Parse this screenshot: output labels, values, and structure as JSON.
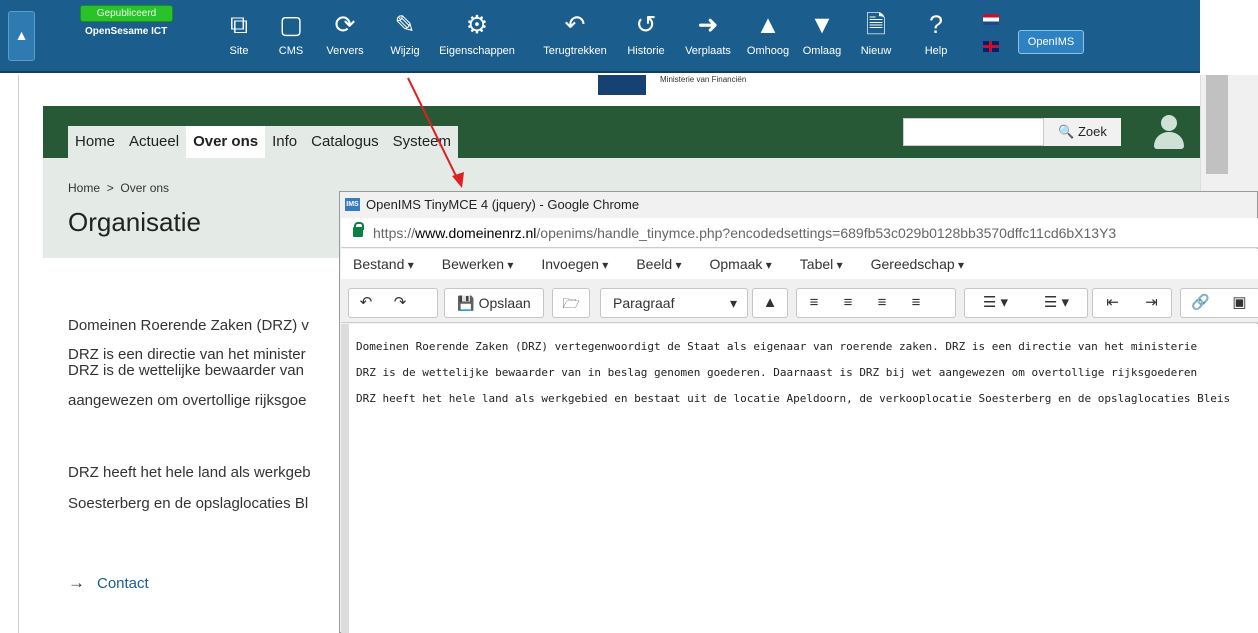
{
  "topbar": {
    "status_badge": "Gepubliceerd",
    "site_name": "OpenSesame ICT",
    "tools": [
      {
        "label": "Site",
        "icon": "expand-icon"
      },
      {
        "label": "CMS",
        "icon": "window-icon"
      },
      {
        "label": "Ververs",
        "icon": "refresh-icon"
      },
      {
        "label": "Wijzig",
        "icon": "edit-icon"
      },
      {
        "label": "Eigenschappen",
        "icon": "gear-icon"
      },
      {
        "label": "Terugtrekken",
        "icon": "undo-icon"
      },
      {
        "label": "Historie",
        "icon": "history-icon"
      },
      {
        "label": "Verplaats",
        "icon": "move-icon"
      },
      {
        "label": "Omhoog",
        "icon": "arrow-up-icon"
      },
      {
        "label": "Omlaag",
        "icon": "arrow-down-icon"
      },
      {
        "label": "Nieuw",
        "icon": "new-page-icon"
      },
      {
        "label": "Help",
        "icon": "help-icon"
      }
    ],
    "openims_button": "OpenIMS",
    "colors": {
      "bar": "#1b5e8e",
      "badge": "#29c229"
    }
  },
  "site": {
    "ministry_text": "Ministerie van Financiën",
    "nav": [
      "Home",
      "Actueel",
      "Over ons",
      "Info",
      "Catalogus",
      "Systeem"
    ],
    "nav_active": "Over ons",
    "search_button": "Zoek",
    "breadcrumb": [
      "Home",
      "Over ons"
    ],
    "breadcrumb_separator": ">",
    "title": "Organisatie",
    "paragraphs": [
      "Domeinen Roerende Zaken (DRZ) v",
      "DRZ is een directie van het minister",
      "DRZ is de wettelijke bewaarder van",
      "aangewezen om overtollige rijksgoe",
      "DRZ heeft het hele land als werkgeb",
      "Soesterberg en de opslaglocaties Bl"
    ],
    "contact": "Contact",
    "colors": {
      "nav": "#275937",
      "band": "#e4ebe6"
    }
  },
  "popup": {
    "window_title": "OpenIMS TinyMCE 4 (jquery) - Google Chrome",
    "url_scheme": "https://",
    "url_domain": "www.domeinenrz.nl",
    "url_rest": "/openims/handle_tinymce.php?encodedsettings=689fb53c029b0128bb3570dffc11cd6bX13Y3",
    "menu": [
      "Bestand",
      "Bewerken",
      "Invoegen",
      "Beeld",
      "Opmaak",
      "Tabel",
      "Gereedschap"
    ],
    "save_label": "Opslaan",
    "format_select": "Paragraaf",
    "editor_lines": [
      "Domeinen Roerende Zaken (DRZ) vertegenwoordigt de Staat als eigenaar van roerende zaken. DRZ is een directie van het ministerie",
      "DRZ is de wettelijke bewaarder van in beslag genomen goederen. Daarnaast is DRZ bij wet aangewezen om overtollige rijksgoederen",
      "DRZ heeft het hele land als werkgebied en bestaat uit de locatie Apeldoorn, de verkooplocatie Soesterberg en de opslaglocaties Bleis"
    ]
  }
}
